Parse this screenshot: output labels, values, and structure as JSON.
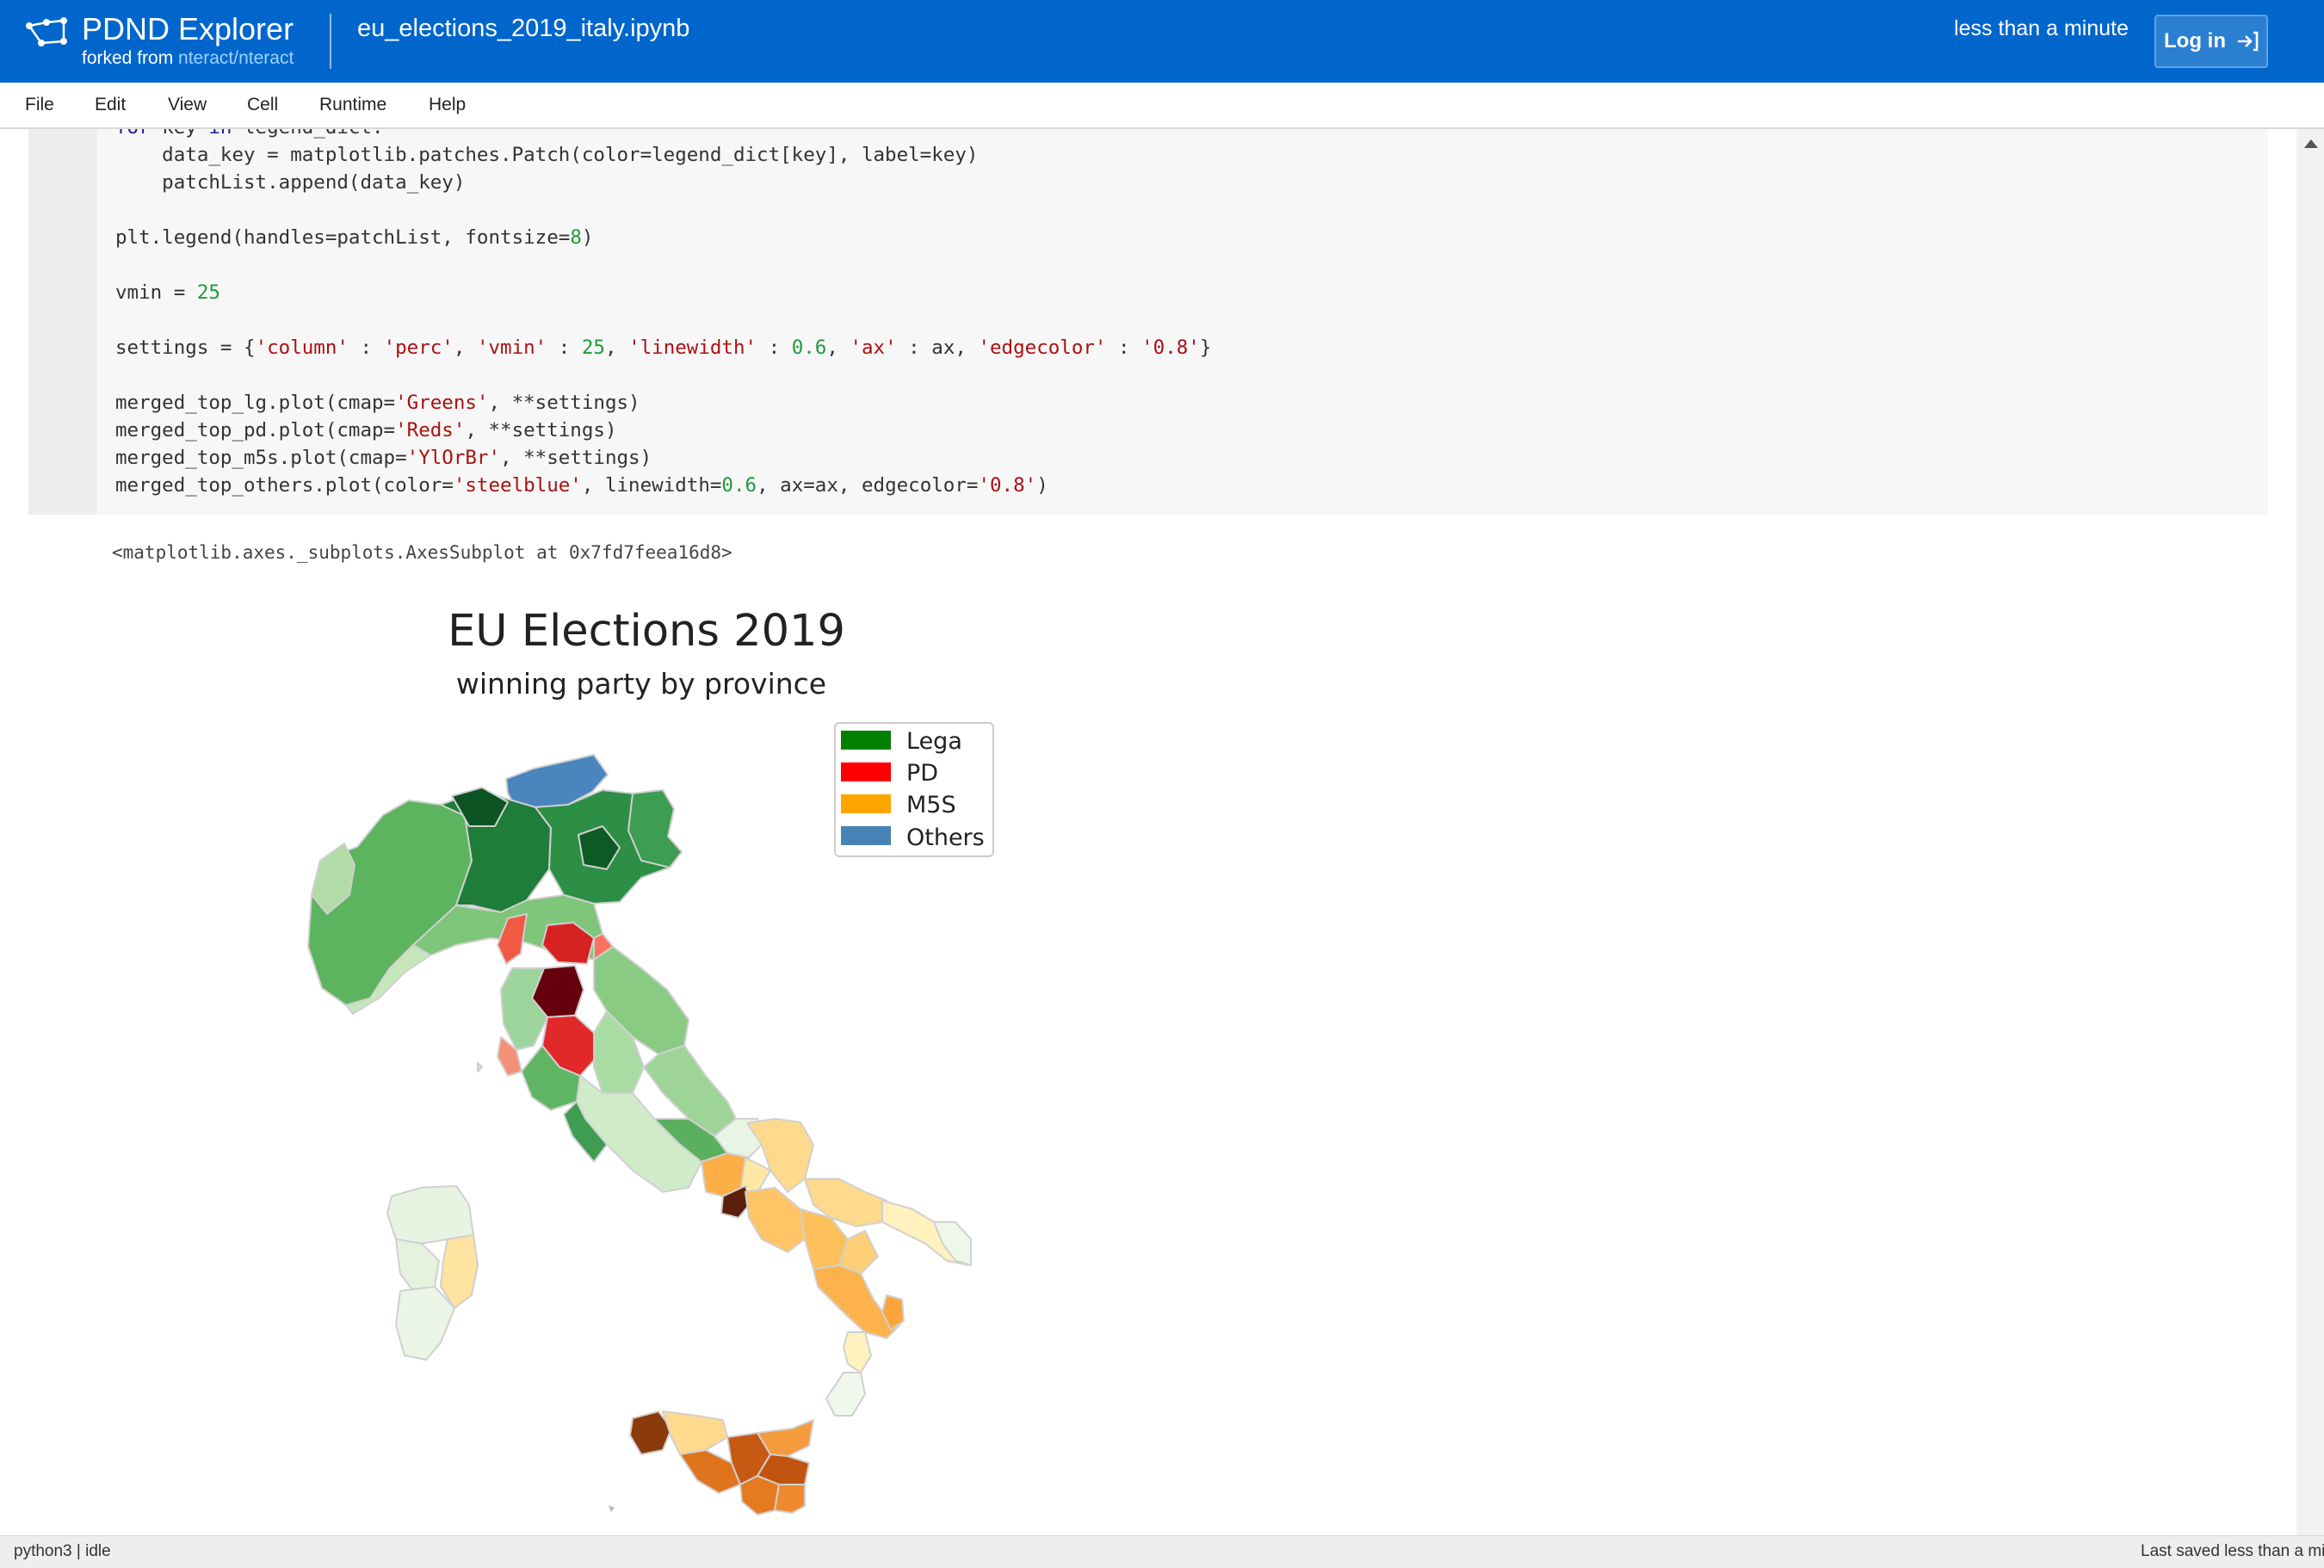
{
  "header": {
    "app_name": "PDND Explorer",
    "forked_prefix": "forked from",
    "forked_link": "nteract/nteract",
    "notebook_title": "eu_elections_2019_italy.ipynb",
    "saved_time": "less than a minute",
    "login_label": "Log in"
  },
  "menu": [
    "File",
    "Edit",
    "View",
    "Cell",
    "Runtime",
    "Help"
  ],
  "code_cell": {
    "lines": [
      "for key in legend_dict:",
      "    data_key = matplotlib.patches.Patch(color=legend_dict[key], label=key)",
      "    patchList.append(data_key)",
      "",
      "plt.legend(handles=patchList, fontsize=8)",
      "",
      "vmin = 25",
      "",
      "settings = {'column' : 'perc', 'vmin' : 25, 'linewidth' : 0.6, 'ax' : ax, 'edgecolor' : '0.8'}",
      "",
      "merged_top_lg.plot(cmap='Greens', **settings)",
      "merged_top_pd.plot(cmap='Reds', **settings)",
      "merged_top_m5s.plot(cmap='YlOrBr', **settings)",
      "merged_top_others.plot(color='steelblue', linewidth=0.6, ax=ax, edgecolor='0.8')"
    ]
  },
  "output": {
    "repr": "<matplotlib.axes._subplots.AxesSubplot at 0x7fd7feea16d8>"
  },
  "figure": {
    "title": "EU Elections 2019",
    "subtitle": "winning party by province",
    "legend": [
      {
        "label": "Lega",
        "color": "#008000"
      },
      {
        "label": "PD",
        "color": "#ff0000"
      },
      {
        "label": "M5S",
        "color": "#ffa500"
      },
      {
        "label": "Others",
        "color": "#4682b4"
      }
    ]
  },
  "statusbar": {
    "kernel": "python3 | idle",
    "last_saved": "Last saved less than a minute ago"
  },
  "colors": {
    "header_bg": "#0066cc",
    "link": "#9cd3ff",
    "code_bg": "#f7f7f7",
    "keyword": "#1a1aa6",
    "string": "#a11",
    "number": "#219a3c"
  }
}
